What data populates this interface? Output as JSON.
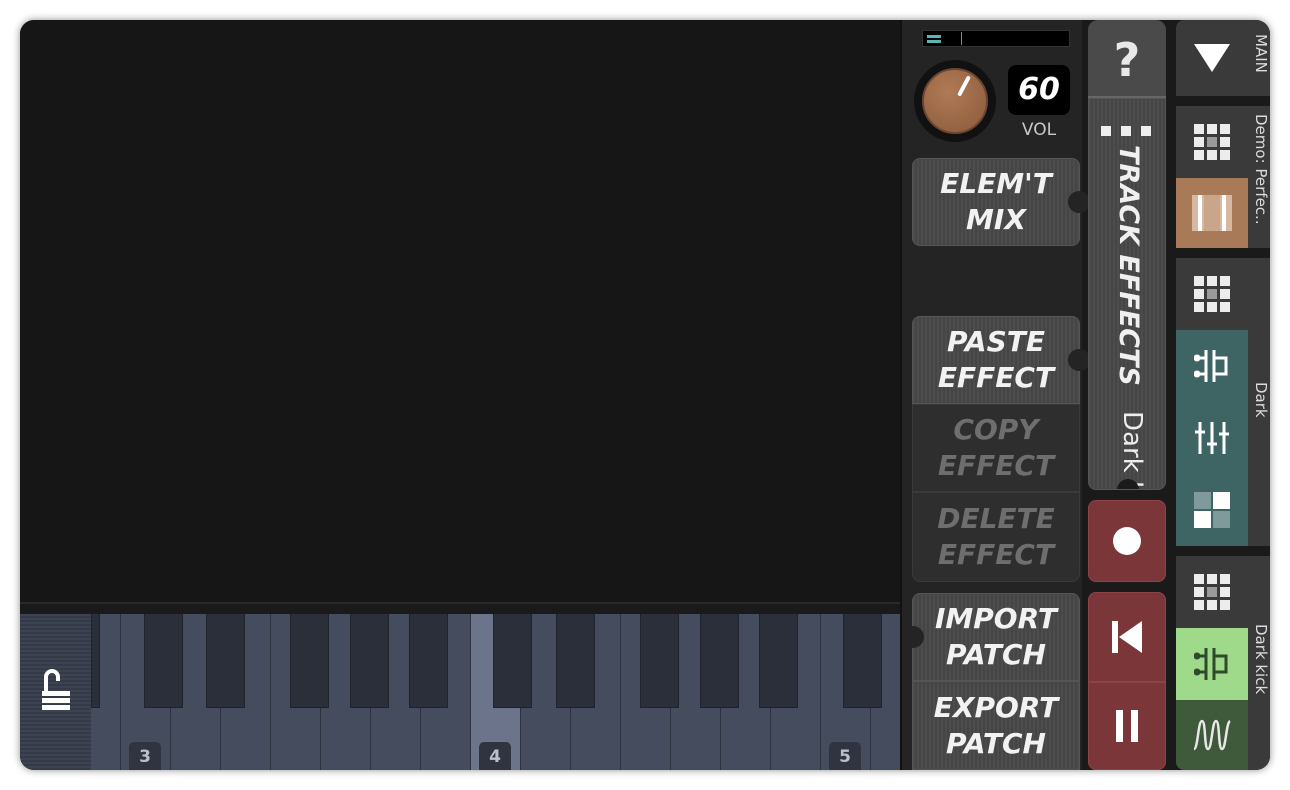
{
  "controls": {
    "volume_value": "60",
    "volume_label": "VOL",
    "elem_mix_line1": "ELEM'T",
    "elem_mix_line2": "MIX",
    "paste_line1": "PASTE",
    "paste_line2": "EFFECT",
    "copy_line1": "COPY",
    "copy_line2": "EFFECT",
    "delete_line1": "DELETE",
    "delete_line2": "EFFECT",
    "import_line1": "IMPORT",
    "import_line2": "PATCH",
    "export_line1": "EXPORT",
    "export_line2": "PATCH"
  },
  "track_panel": {
    "help_label": "?",
    "track_effects_label": "TRACK EFFECTS",
    "track_name": "Dark kick"
  },
  "keyboard": {
    "octaves": [
      "3",
      "4",
      "5"
    ]
  },
  "sidebar": {
    "main_label": "MAIN",
    "song_label": "Demo: Perfec..",
    "track_label": "Dark",
    "instrument_label": "Dark kick"
  },
  "colors": {
    "accent_brown": "#a87a58",
    "teal_tile": "#3f6464",
    "green_tile_light": "#9fd98a",
    "green_tile_dark": "#3f5a3a",
    "transport_red": "#7a3638",
    "meter_cyan": "#5bb5b5"
  },
  "icons": {
    "main": "triangle-down-icon",
    "grid": "grid-icon",
    "song": "song-bars-icon",
    "connector": "connector-icon",
    "mixer": "mixer-sliders-icon",
    "pattern": "pattern-squares-icon",
    "waveform": "waveform-icon",
    "lock": "unlocked-padlock-icon",
    "record": "record-icon",
    "rewind": "rewind-icon",
    "pause": "pause-icon"
  }
}
